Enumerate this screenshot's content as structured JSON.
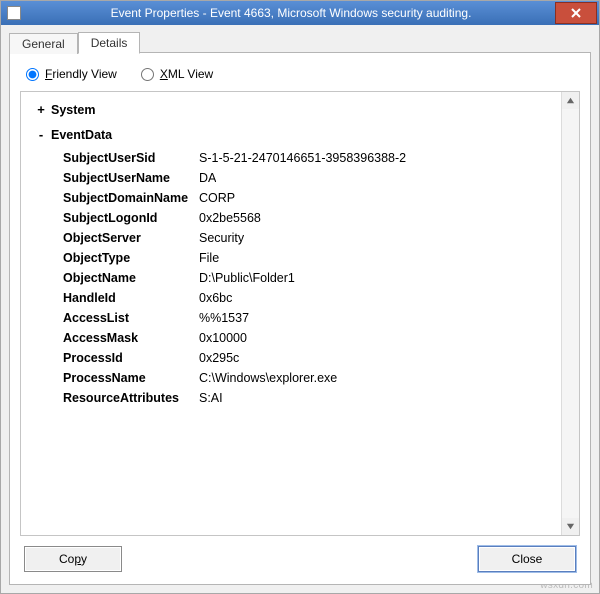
{
  "window": {
    "title": "Event Properties - Event 4663, Microsoft Windows security auditing."
  },
  "tabs": {
    "general": "General",
    "details": "Details"
  },
  "views": {
    "friendly": "Friendly View",
    "xml": "XML View"
  },
  "tree": {
    "system": "System",
    "eventdata": "EventData"
  },
  "fields": [
    {
      "key": "SubjectUserSid",
      "value": "S-1-5-21-2470146651-3958396388-2"
    },
    {
      "key": "SubjectUserName",
      "value": "DA"
    },
    {
      "key": "SubjectDomainName",
      "value": "CORP"
    },
    {
      "key": "SubjectLogonId",
      "value": "0x2be5568"
    },
    {
      "key": "ObjectServer",
      "value": "Security"
    },
    {
      "key": "ObjectType",
      "value": "File"
    },
    {
      "key": "ObjectName",
      "value": "D:\\Public\\Folder1"
    },
    {
      "key": "HandleId",
      "value": "0x6bc"
    },
    {
      "key": "AccessList",
      "value": "%%1537"
    },
    {
      "key": "AccessMask",
      "value": "0x10000"
    },
    {
      "key": "ProcessId",
      "value": "0x295c"
    },
    {
      "key": "ProcessName",
      "value": "C:\\Windows\\explorer.exe"
    },
    {
      "key": "ResourceAttributes",
      "value": "S:AI"
    }
  ],
  "buttons": {
    "copy": "Copy",
    "close": "Close"
  },
  "watermark": "wsxdn.com"
}
